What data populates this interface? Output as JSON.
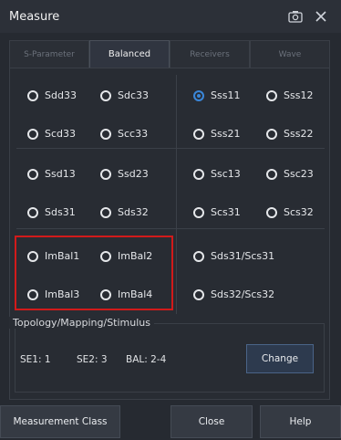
{
  "window": {
    "title": "Measure",
    "icons": [
      "screenshot-icon",
      "close-icon"
    ]
  },
  "tabs": [
    "S-Parameter",
    "Balanced",
    "Receivers",
    "Wave"
  ],
  "active_tab": "Balanced",
  "options": [
    [
      "Sdd33",
      "Sdc33",
      "Sss11",
      "Sss12"
    ],
    [
      "Scd33",
      "Scc33",
      "Sss21",
      "Sss22"
    ],
    [
      "Ssd13",
      "Ssd23",
      "Ssc13",
      "Ssc23"
    ],
    [
      "Sds31",
      "Sds32",
      "Scs31",
      "Scs32"
    ],
    [
      "ImBal1",
      "ImBal2",
      "Sds31/Scs31"
    ],
    [
      "ImBal3",
      "ImBal4",
      "Sds32/Scs32"
    ]
  ],
  "selected": "Sss11",
  "topology": {
    "label": "Topology/Mapping/Stimulus",
    "se1": "SE1: 1",
    "se2": "SE2: 3",
    "bal": "BAL: 2-4",
    "change_label": "Change"
  },
  "footer": {
    "measurement_class": "Measurement Class",
    "close": "Close",
    "help": "Help"
  },
  "colors": {
    "accent": "#3a86d8",
    "highlight_box": "#d11a1a"
  }
}
